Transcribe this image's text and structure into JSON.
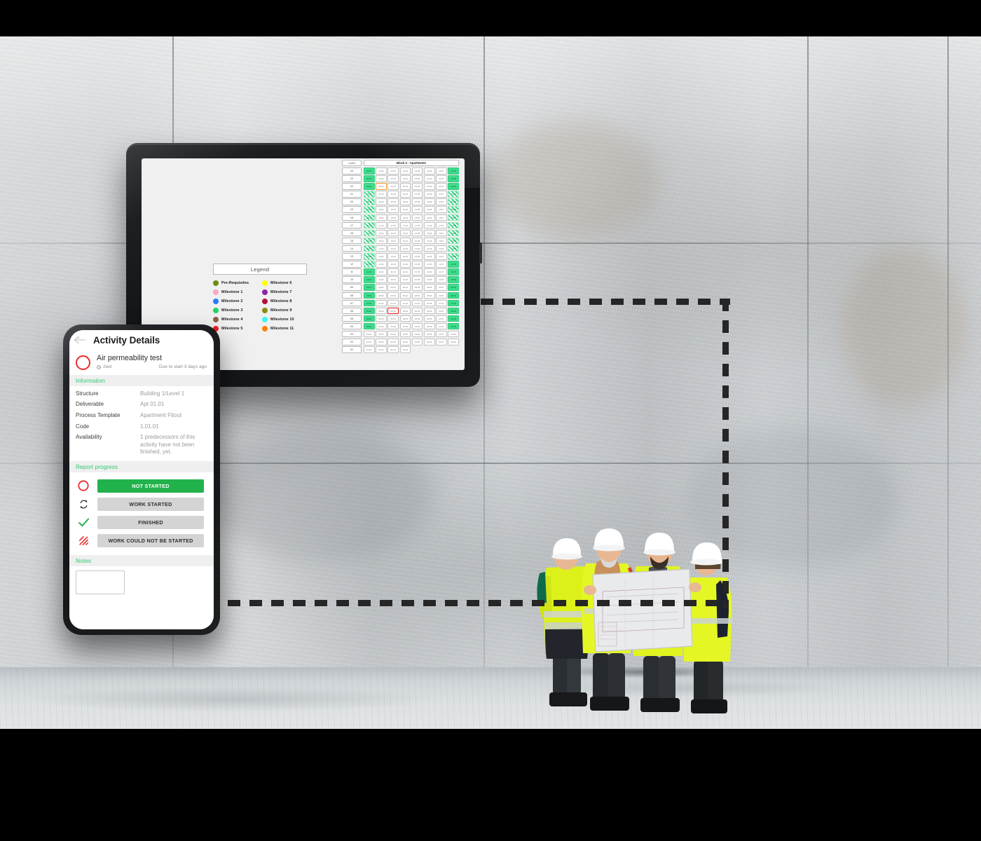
{
  "scene": {
    "description": "Construction site concrete wall with four workers reviewing blueprints",
    "workers_count": 4,
    "dashed_connector_color": "#262626"
  },
  "tablet": {
    "legend": {
      "title": "Legend",
      "items": [
        {
          "label": "Pre-Requisites",
          "color": "#6b8e0b"
        },
        {
          "label": "Milestone 6",
          "color": "#ffff00"
        },
        {
          "label": "Milestone 1",
          "color": "#f9a8c4"
        },
        {
          "label": "Milestone 7",
          "color": "#8e24aa"
        },
        {
          "label": "Milestone 2",
          "color": "#2979ff"
        },
        {
          "label": "Milestone 8",
          "color": "#b0123c"
        },
        {
          "label": "Milestone 3",
          "color": "#1ed760"
        },
        {
          "label": "Milestone 9",
          "color": "#8a8b11"
        },
        {
          "label": "Milestone 4",
          "color": "#8d6248"
        },
        {
          "label": "Milestone 10",
          "color": "#3ef2f2"
        },
        {
          "label": "Milestone 5",
          "color": "#f51d24"
        },
        {
          "label": "Milestone 11",
          "color": "#f98109"
        }
      ]
    },
    "matrix": {
      "levels_header": "Levels",
      "block_header": "Block A - Apartments",
      "cell_prefixes": [
        "01",
        "02",
        "03",
        "04",
        "05",
        "06",
        "07",
        "08"
      ],
      "rows": [
        {
          "level": "24",
          "cells": [
            "green",
            "plain",
            "plain",
            "plain",
            "plain",
            "plain",
            "plain",
            "green"
          ]
        },
        {
          "level": "23",
          "cells": [
            "green",
            "plain",
            "plain",
            "plain",
            "plain",
            "plain",
            "plain",
            "green"
          ]
        },
        {
          "level": "22",
          "cells": [
            "green",
            "sel-orange",
            "plain",
            "plain",
            "plain",
            "plain",
            "plain",
            "green"
          ]
        },
        {
          "level": "21",
          "cells": [
            "hatch",
            "plain",
            "plain",
            "plain",
            "plain",
            "plain",
            "plain",
            "hatch"
          ]
        },
        {
          "level": "20",
          "cells": [
            "hatch",
            "plain",
            "plain",
            "plain",
            "plain",
            "plain",
            "plain",
            "hatch"
          ]
        },
        {
          "level": "19",
          "cells": [
            "hatch",
            "plain",
            "plain",
            "plain",
            "plain",
            "plain",
            "plain",
            "hatch"
          ]
        },
        {
          "level": "18",
          "cells": [
            "hatch",
            "plain",
            "plain",
            "plain",
            "plain",
            "plain",
            "plain",
            "hatch"
          ]
        },
        {
          "level": "17",
          "cells": [
            "hatch",
            "plain",
            "plain",
            "plain",
            "plain",
            "plain",
            "plain",
            "hatch"
          ]
        },
        {
          "level": "16",
          "cells": [
            "hatch",
            "plain",
            "plain",
            "plain",
            "plain",
            "plain",
            "plain",
            "hatch"
          ]
        },
        {
          "level": "15",
          "cells": [
            "hatch",
            "plain",
            "plain",
            "plain",
            "plain",
            "plain",
            "plain",
            "hatch"
          ]
        },
        {
          "level": "14",
          "cells": [
            "hatch",
            "plain",
            "plain",
            "plain",
            "plain",
            "plain",
            "plain",
            "hatch"
          ]
        },
        {
          "level": "13",
          "cells": [
            "hatch",
            "plain",
            "plain",
            "plain",
            "plain",
            "plain",
            "plain",
            "hatch"
          ]
        },
        {
          "level": "12",
          "cells": [
            "hatch",
            "plain",
            "plain",
            "plain",
            "plain",
            "plain",
            "plain",
            "green"
          ]
        },
        {
          "level": "11",
          "cells": [
            "green",
            "plain",
            "plain",
            "plain",
            "plain",
            "plain",
            "plain",
            "green"
          ]
        },
        {
          "level": "10",
          "cells": [
            "green",
            "plain",
            "plain",
            "plain",
            "plain",
            "plain",
            "plain",
            "green"
          ]
        },
        {
          "level": "09",
          "cells": [
            "green",
            "plain",
            "plain",
            "plain",
            "plain",
            "plain",
            "plain",
            "green"
          ]
        },
        {
          "level": "08",
          "cells": [
            "green",
            "plain",
            "plain",
            "plain",
            "plain",
            "plain",
            "plain",
            "green"
          ]
        },
        {
          "level": "07",
          "cells": [
            "green",
            "plain",
            "plain",
            "plain",
            "plain",
            "plain",
            "plain",
            "green"
          ]
        },
        {
          "level": "06",
          "cells": [
            "green",
            "plain",
            "sel-red",
            "plain",
            "plain",
            "plain",
            "plain",
            "green"
          ]
        },
        {
          "level": "05",
          "cells": [
            "green",
            "plain",
            "plain",
            "plain",
            "plain",
            "plain",
            "plain",
            "green"
          ]
        },
        {
          "level": "04",
          "cells": [
            "green",
            "plain",
            "plain",
            "plain",
            "plain",
            "plain",
            "plain",
            "green"
          ]
        },
        {
          "level": "03",
          "cells": [
            "plain",
            "plain",
            "plain",
            "plain",
            "plain",
            "plain",
            "plain",
            "plain"
          ]
        },
        {
          "level": "02",
          "cells": [
            "plain",
            "plain",
            "plain",
            "plain",
            "plain",
            "plain",
            "plain",
            "plain"
          ]
        },
        {
          "level": "01",
          "cells": [
            "plain",
            "plain",
            "plain",
            "plain"
          ]
        }
      ]
    }
  },
  "phone": {
    "header": {
      "title": "Activity Details",
      "back_icon": "back-arrow-icon"
    },
    "task": {
      "name": "Air permeability test",
      "duration": "2wd",
      "duration_icon": "clock-icon",
      "due": "Due to start 3 days ago",
      "status_icon": "not-started-ring-icon",
      "status_color": "#ef2b2b"
    },
    "information": {
      "section_title": "Information",
      "rows": [
        {
          "key": "Structure",
          "value": "Building 1/Level 1"
        },
        {
          "key": "Deliverable",
          "value": "Apt 01.01"
        },
        {
          "key": "Process Template",
          "value": "Apartment Fitout"
        },
        {
          "key": "Code",
          "value": "1.01.01"
        },
        {
          "key": "Availability",
          "value": "1 predecessors of this activity have not been finished, yet."
        }
      ]
    },
    "report_progress": {
      "section_title": "Report progress",
      "options": [
        {
          "label": "NOT STARTED",
          "icon": "circle-outline-icon",
          "active": true
        },
        {
          "label": "WORK STARTED",
          "icon": "refresh-cycle-icon",
          "active": false
        },
        {
          "label": "FINISHED",
          "icon": "checkmark-icon",
          "active": false
        },
        {
          "label": "WORK COULD NOT BE STARTED",
          "icon": "hatched-square-icon",
          "active": false
        }
      ],
      "active_color": "#22b24c",
      "inactive_color": "#d4d4d4"
    },
    "notes": {
      "section_title": "Notes",
      "value": "",
      "placeholder": ""
    }
  }
}
